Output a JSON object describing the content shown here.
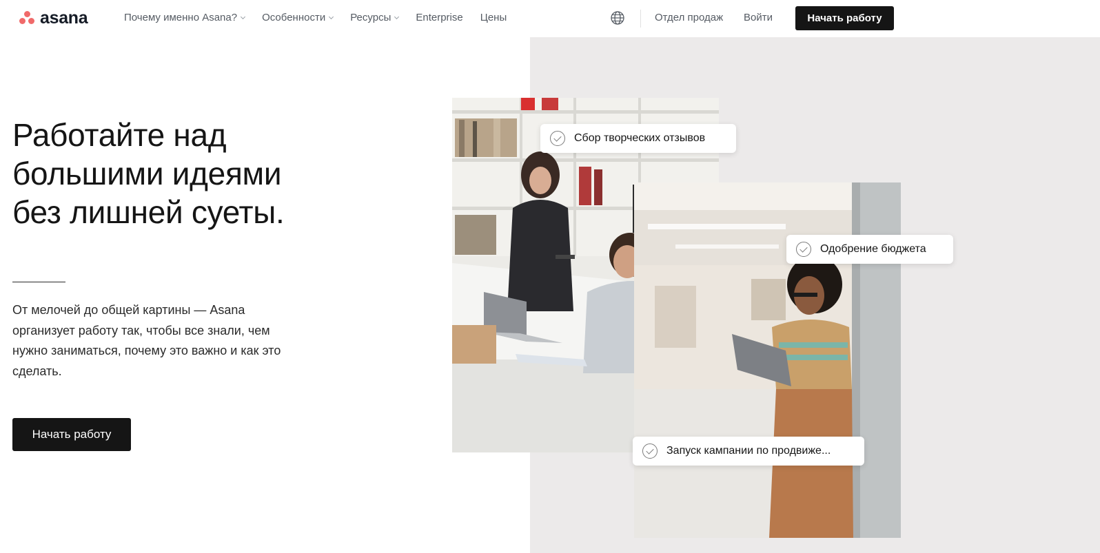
{
  "header": {
    "logo_text": "asana",
    "nav": [
      {
        "label": "Почему именно Asana?",
        "has_dropdown": true
      },
      {
        "label": "Особенности",
        "has_dropdown": true
      },
      {
        "label": "Ресурсы",
        "has_dropdown": true
      },
      {
        "label": "Enterprise",
        "has_dropdown": false
      },
      {
        "label": "Цены",
        "has_dropdown": false
      }
    ],
    "language_icon": "globe-icon",
    "sales_label": "Отдел продаж",
    "login_label": "Войти",
    "cta_label": "Начать работу"
  },
  "hero": {
    "title": "Работайте над большими идеями без лишней суеты.",
    "description": "От мелочей до общей картины — Asana организует работу так, чтобы все знали, чем нужно заниматься, почему это важно и как это сделать.",
    "cta_label": "Начать работу"
  },
  "task_cards": [
    {
      "label": "Сбор творческих отзывов",
      "icon": "check-circle-icon"
    },
    {
      "label": "Одобрение бюджета",
      "icon": "check-circle-icon"
    },
    {
      "label": "Запуск кампании по продвиже...",
      "icon": "check-circle-icon"
    }
  ],
  "colors": {
    "brand_coral": "#f06a6a",
    "button_dark": "#151515",
    "panel_bg": "#eceaea"
  }
}
